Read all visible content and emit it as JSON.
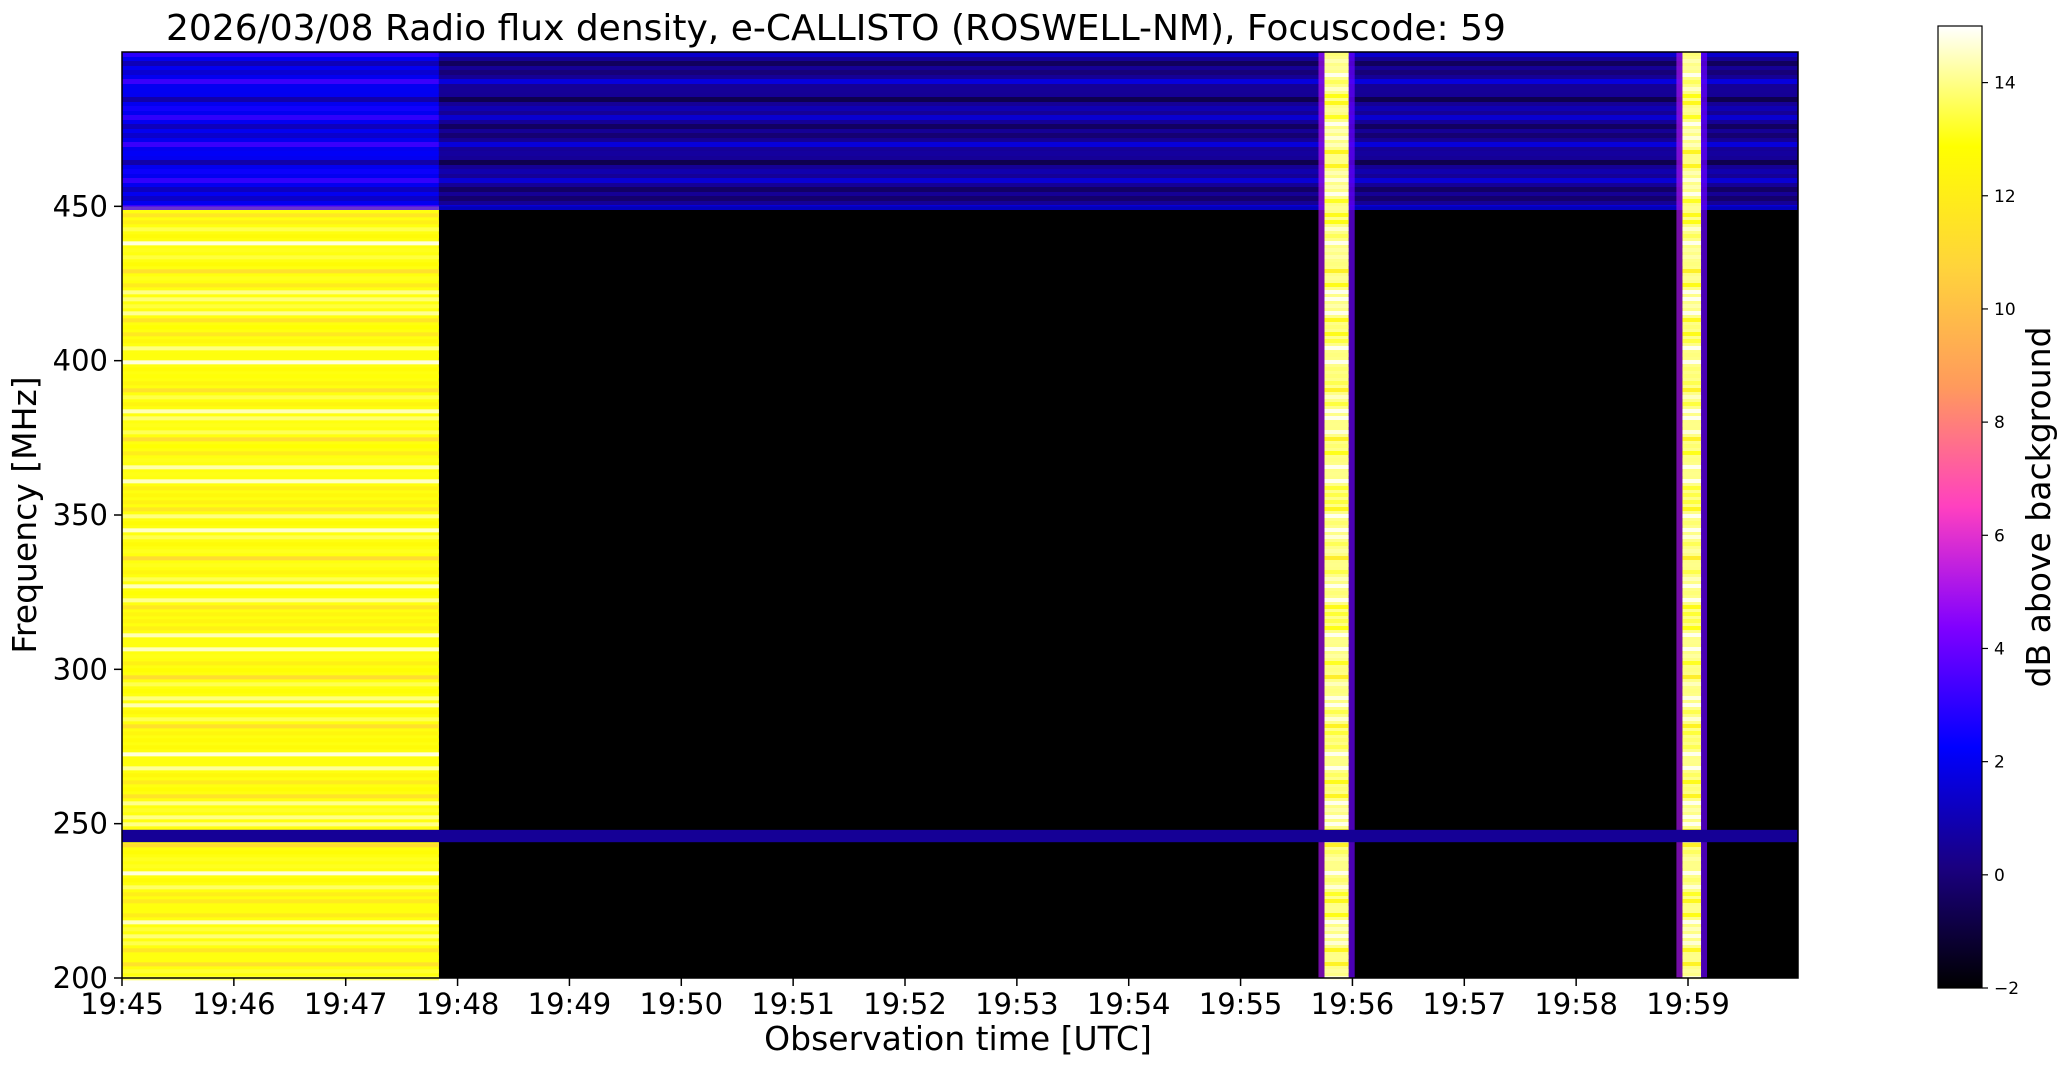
{
  "chart_data": {
    "type": "heatmap",
    "title": "2026/03/08  Radio flux density, e-CALLISTO (ROSWELL-NM), Focuscode: 59",
    "xlabel": "Observation time [UTC]",
    "ylabel": "Frequency [MHz]",
    "xlim": [
      "19:45",
      "19:59:59"
    ],
    "ylim": [
      200,
      500
    ],
    "x_ticks": [
      "19:45",
      "19:46",
      "19:47",
      "19:48",
      "19:49",
      "19:50",
      "19:51",
      "19:52",
      "19:53",
      "19:54",
      "19:55",
      "19:56",
      "19:57",
      "19:58",
      "19:59"
    ],
    "y_ticks": [
      200,
      250,
      300,
      350,
      400,
      450
    ],
    "colorbar": {
      "label": "dB above background",
      "range": [
        -2,
        15
      ],
      "ticks": [
        -2,
        0,
        2,
        4,
        6,
        8,
        10,
        12,
        14
      ],
      "colormap": [
        "#000000",
        "#1a0080",
        "#0000ff",
        "#8000ff",
        "#ff40c0",
        "#ff9a5c",
        "#ffd43b",
        "#ffff00",
        "#ffffff"
      ]
    },
    "regions": [
      {
        "name": "strong broadband emission",
        "t_start": "19:45:00",
        "t_end": "19:47:50",
        "f_start": 200,
        "f_end": 450,
        "level_db": 13
      },
      {
        "name": "strong band 450-500 MHz",
        "t_start": "19:45:00",
        "t_end": "19:47:50",
        "f_start": 450,
        "f_end": 500,
        "level_db": 2
      },
      {
        "name": "persistent band 450-500 MHz",
        "t_start": "19:47:50",
        "t_end": "19:59:59",
        "f_start": 450,
        "f_end": 500,
        "level_db": 0.5
      },
      {
        "name": "burst",
        "t_start": "19:55:45",
        "t_end": "19:55:58",
        "f_start": 200,
        "f_end": 500,
        "level_db": 14
      },
      {
        "name": "burst",
        "t_start": "19:58:57",
        "t_end": "19:59:07",
        "f_start": 200,
        "f_end": 500,
        "level_db": 14
      },
      {
        "name": "interference band",
        "t_start": "19:45:00",
        "t_end": "19:59:59",
        "f_start": 244,
        "f_end": 248,
        "level_db": 0.5
      }
    ]
  }
}
